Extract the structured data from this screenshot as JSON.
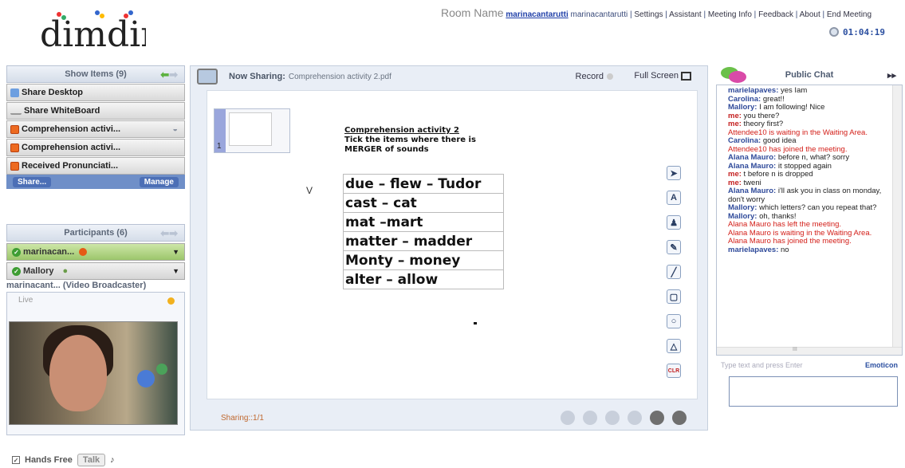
{
  "header": {
    "logo_text": "dimdim",
    "room_name_label": "Room Name",
    "room_name_value": "marinacantarutti",
    "user_name": "marinacantarutti",
    "links": [
      "Settings",
      "Assistant",
      "Meeting Info",
      "Feedback",
      "About",
      "End Meeting"
    ],
    "timer": "01:04:19"
  },
  "left": {
    "show_items_title": "Show Items (9)",
    "items": [
      {
        "label": "Share Desktop",
        "icon": "monitor-icon"
      },
      {
        "label": "Share WhiteBoard",
        "icon": "pen-icon"
      },
      {
        "label": "Comprehension activi...",
        "icon": "ppt-icon"
      },
      {
        "label": "Comprehension activi...",
        "icon": "ppt-icon"
      },
      {
        "label": "Received Pronunciati...",
        "icon": "ppt-icon"
      }
    ],
    "share_label": "Share...",
    "manage_label": "Manage",
    "participants_title": "Participants (6)",
    "participants": [
      {
        "name": "marinacan..."
      },
      {
        "name": "Mallory"
      }
    ],
    "video_title": "marinacant... (Video Broadcaster)",
    "live_label": "Live",
    "hands_free_label": "Hands Free",
    "talk_label": "Talk"
  },
  "center": {
    "now_sharing_label": "Now Sharing:",
    "file_name": "Comprehension activity 2.pdf",
    "record_label": "Record",
    "fullscreen_label": "Full Screen",
    "thumb_number": "1",
    "doc_title_lines": [
      "Comprehension activity 2",
      "Tick the items where there is",
      "MERGER of sounds"
    ],
    "v_mark": "V",
    "word_rows": [
      "due – flew – Tudor",
      "cast – cat",
      "mat –mart",
      "matter – madder",
      "Monty – money",
      "alter – allow"
    ],
    "tools": [
      "arrow",
      "A",
      "stamp",
      "pencil",
      "line",
      "rectangle",
      "circle",
      "triangle",
      "CLR"
    ],
    "sharing_page": "Sharing::1/1"
  },
  "chat": {
    "title": "Public Chat",
    "messages": [
      {
        "who": "marielapaves:",
        "text": " yes Iam",
        "kind": "user"
      },
      {
        "who": "Carolina:",
        "text": " great!!",
        "kind": "user"
      },
      {
        "who": "Mallory:",
        "text": " I am following! Nice",
        "kind": "user"
      },
      {
        "who": "me:",
        "text": " you there?",
        "kind": "me"
      },
      {
        "who": "me:",
        "text": " theory first?",
        "kind": "me"
      },
      {
        "who": "",
        "text": "Attendee10 is waiting in the Waiting Area.",
        "kind": "sys"
      },
      {
        "who": "Carolina:",
        "text": " good idea",
        "kind": "user"
      },
      {
        "who": "",
        "text": "Attendee10 has joined the meeting.",
        "kind": "sys"
      },
      {
        "who": "Alana Mauro:",
        "text": " before n, what? sorry",
        "kind": "user"
      },
      {
        "who": "Alana Mauro:",
        "text": " it stopped again",
        "kind": "user"
      },
      {
        "who": "me:",
        "text": " t before n is dropped",
        "kind": "me"
      },
      {
        "who": "me:",
        "text": " tweni",
        "kind": "me"
      },
      {
        "who": "Alana Mauro:",
        "text": " i'll ask you in class on monday, don't worry",
        "kind": "user"
      },
      {
        "who": "Mallory:",
        "text": " which letters? can you repeat that?",
        "kind": "user"
      },
      {
        "who": "Mallory:",
        "text": " oh, thanks!",
        "kind": "user"
      },
      {
        "who": "",
        "text": "Alana Mauro has left the meeting.",
        "kind": "sys"
      },
      {
        "who": "",
        "text": "Alana Mauro is waiting in the Waiting Area.",
        "kind": "sys"
      },
      {
        "who": "",
        "text": "Alana Mauro has joined the meeting.",
        "kind": "sys"
      },
      {
        "who": "marielapaves:",
        "text": " no",
        "kind": "user"
      }
    ],
    "scroll_label": "III",
    "input_placeholder": "Type text and press Enter",
    "emoticon_label": "Emoticon"
  },
  "colors": {
    "accent": "#2b4fa0",
    "system_message": "#d3201a",
    "active_participant": "#9cc66b"
  }
}
